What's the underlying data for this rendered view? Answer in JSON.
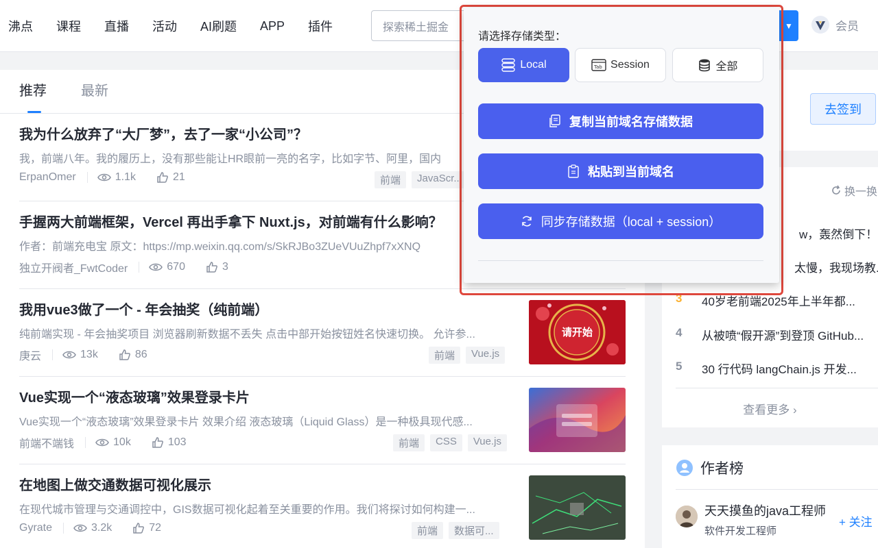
{
  "header": {
    "nav": [
      "沸点",
      "课程",
      "直播",
      "活动",
      "AI刷题",
      "APP",
      "插件"
    ],
    "search_placeholder": "探索稀土掘金",
    "vip_label": "会员"
  },
  "feed": {
    "tabs": [
      "推荐",
      "最新"
    ],
    "articles": [
      {
        "title": "我为什么放弃了“大厂梦”，去了一家“小公司”？",
        "desc": "我，前端八年。我的履历上，没有那些能让HR眼前一亮的名字，比如字节、阿里，国内",
        "author": "ErpanOmer",
        "views": "1.1k",
        "likes": "21",
        "tags": [
          "前端",
          "JavaScr..."
        ]
      },
      {
        "title": "手握两大前端框架，Vercel 再出手拿下 Nuxt.js，对前端有什么影响？",
        "desc": "作者：前端充电宝 原文：https://mp.weixin.qq.com/s/SkRJBo3ZUeVUuZhpf7xXNQ",
        "author": "独立开阀者_FwtCoder",
        "views": "670",
        "likes": "3",
        "tags": []
      },
      {
        "title": "我用vue3做了一个 - 年会抽奖（纯前端）",
        "desc": "纯前端实现 - 年会抽奖项目 浏览器刷新数据不丢失 点击中部开始按钮姓名快速切换。 允许参...",
        "author": "庚云",
        "views": "13k",
        "likes": "86",
        "tags": [
          "前端",
          "Vue.js"
        ],
        "thumb_text": "请开始"
      },
      {
        "title": "Vue实现一个“液态玻璃”效果登录卡片",
        "desc": "Vue实现一个“液态玻璃”效果登录卡片 效果介绍 液态玻璃（Liquid Glass）是一种极具现代感...",
        "author": "前端不端钱",
        "views": "10k",
        "likes": "103",
        "tags": [
          "前端",
          "CSS",
          "Vue.js"
        ]
      },
      {
        "title": "在地图上做交通数据可视化展示",
        "desc": "在现代城市管理与交通调控中，GIS数据可视化起着至关重要的作用。我们将探讨如何构建一...",
        "author": "Gyrate",
        "views": "3.2k",
        "likes": "72",
        "tags": [
          "前端",
          "数据可..."
        ]
      }
    ]
  },
  "sidebar": {
    "sign_in_label": "去签到",
    "refresh_label": "换一换",
    "hot_list": [
      {
        "num": "",
        "text": "w，轰然倒下！"
      },
      {
        "num": "",
        "text": "太慢，我现场教..."
      },
      {
        "num": "3",
        "text": "40岁老前端2025年上半年都..."
      },
      {
        "num": "4",
        "text": "从被喷“假开源”到登顶 GitHub..."
      },
      {
        "num": "5",
        "text": "30 行代码 langChain.js 开发..."
      }
    ],
    "more_label": "查看更多",
    "authors_title": "作者榜",
    "author": {
      "name": "天天摸鱼的java工程师",
      "job": "软件开发工程师",
      "follow": "+ 关注"
    }
  },
  "popup": {
    "label": "请选择存储类型：",
    "storage_types": [
      "Local",
      "Session",
      "全部"
    ],
    "selected": "Local",
    "actions": [
      "复制当前域名存储数据",
      "粘贴到当前域名",
      "同步存储数据（local + session）"
    ],
    "accent_color": "#4a5fee",
    "frame_color": "#e0483d"
  }
}
